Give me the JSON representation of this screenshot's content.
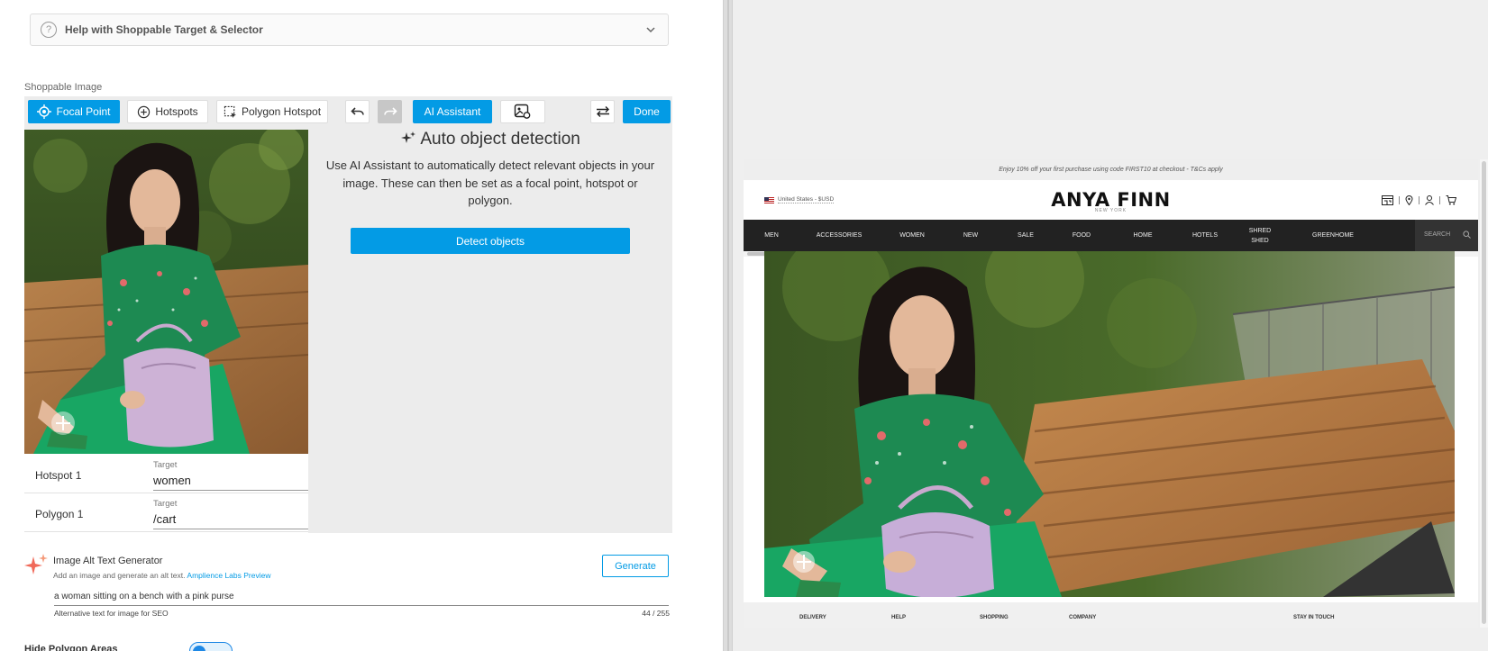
{
  "help_panel": {
    "title": "Help with Shoppable Target & Selector"
  },
  "shoppable": {
    "section_label": "Shoppable Image",
    "toolbar": {
      "focal_point": "Focal Point",
      "hotspots": "Hotspots",
      "polygon_hotspot": "Polygon Hotspot",
      "ai_assistant": "AI Assistant",
      "done": "Done"
    },
    "ai": {
      "title": "Auto object detection",
      "description": "Use AI Assistant to automatically detect relevant objects in your image. These can then be set as a focal point, hotspot or polygon.",
      "detect_button": "Detect objects"
    },
    "rows": [
      {
        "name": "Hotspot 1",
        "target_label": "Target",
        "target_value": "women"
      },
      {
        "name": "Polygon 1",
        "target_label": "Target",
        "target_value": "/cart"
      }
    ]
  },
  "alt_text": {
    "title": "Image Alt Text Generator",
    "subtitle": "Add an image and generate an alt text.",
    "link": "Amplience Labs Preview",
    "generate_button": "Generate",
    "value": "a woman sitting on a bench with a pink purse",
    "helper": "Alternative text for image for SEO",
    "counter": "44 / 255"
  },
  "hide_polygon_label": "Hide Polygon Areas",
  "preview": {
    "promo": "Enjoy 10% off your first purchase using code FIRST10 at checkout - T&Cs apply",
    "region": "United States - $USD",
    "logo": "ANYA FINN",
    "logo_sub": "NEW YORK",
    "nav": [
      "MEN",
      "ACCESSORIES",
      "WOMEN",
      "NEW",
      "SALE",
      "FOOD",
      "HOME",
      "HOTELS",
      "SHRED SHED",
      "GREENHOME"
    ],
    "search_placeholder": "SEARCH",
    "footer_headings": [
      "DELIVERY",
      "HELP",
      "SHOPPING",
      "COMPANY",
      "STAY IN TOUCH"
    ]
  },
  "colors": {
    "accent": "#039be5",
    "nav_bg": "#222222"
  }
}
